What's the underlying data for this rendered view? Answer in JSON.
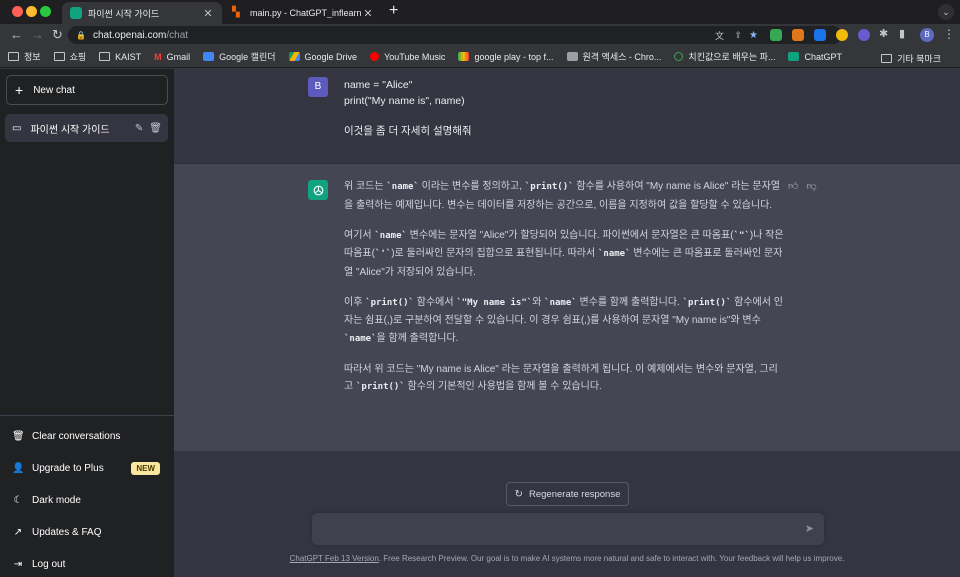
{
  "browser": {
    "tabs": [
      {
        "title": "파이썬 시작 가이드",
        "active": true,
        "favicon": "chatgpt-favicon-icon",
        "color": "#10a37f"
      },
      {
        "title": "main.py - ChatGPT_inflearn",
        "active": false,
        "favicon": "replit-favicon-icon",
        "color": "#f26207"
      }
    ],
    "new_tab": "+",
    "url_host": "chat.openai.com",
    "url_path": "/chat",
    "profile_initial": "B",
    "bookmarks": [
      {
        "label": "정보",
        "icon": "folder-icon"
      },
      {
        "label": "쇼핑",
        "icon": "folder-icon"
      },
      {
        "label": "KAIST",
        "icon": "folder-icon"
      },
      {
        "label": "Gmail",
        "icon": "gmail-icon"
      },
      {
        "label": "Google 캘린더",
        "icon": "calendar-icon"
      },
      {
        "label": "Google Drive",
        "icon": "drive-icon"
      },
      {
        "label": "YouTube Music",
        "icon": "youtube-music-icon"
      },
      {
        "label": "google play - top f...",
        "icon": "play-icon"
      },
      {
        "label": "원격 액세스 - Chro...",
        "icon": "remote-icon"
      },
      {
        "label": "치킨값으로 배우는 파...",
        "icon": "site-icon"
      },
      {
        "label": "ChatGPT",
        "icon": "chatgpt-icon"
      }
    ],
    "other_bookmarks": "기타 북마크"
  },
  "sidebar": {
    "new_chat": "New chat",
    "conversations": [
      {
        "title": "파이썬 시작 가이드"
      }
    ],
    "bottom_items": [
      {
        "label": "Clear conversations",
        "icon": "trash-icon",
        "glyph": "🗑"
      },
      {
        "label": "Upgrade to Plus",
        "icon": "user-icon",
        "glyph": "👤",
        "badge": "NEW"
      },
      {
        "label": "Dark mode",
        "icon": "moon-icon",
        "glyph": "☾"
      },
      {
        "label": "Updates & FAQ",
        "icon": "external-link-icon",
        "glyph": "↗"
      },
      {
        "label": "Log out",
        "icon": "logout-icon",
        "glyph": "⇥"
      }
    ]
  },
  "chat": {
    "user_avatar": "B",
    "user_lines": [
      "name = \"Alice\"",
      "print(\"My name is\", name)"
    ],
    "user_request": "이것을 좀 더 자세히 설명해줘",
    "bot_paragraphs": [
      [
        {
          "t": "위 코드는 "
        },
        {
          "c": "`name`"
        },
        {
          "t": " 이라는 변수를 정의하고, "
        },
        {
          "c": "`print()`"
        },
        {
          "t": " 함수를 사용하여 \"My name is Alice\" 라는 문자열을 출력하는 예제입니다. 변수는 데이터를 저장하는 공간으로, 이름을 지정하여 값을 할당할 수 있습니다."
        }
      ],
      [
        {
          "t": "여기서 "
        },
        {
          "c": "`name`"
        },
        {
          "t": " 변수에는 문자열 \"Alice\"가 할당되어 있습니다. 파이썬에서 문자열은 큰 따옴표("
        },
        {
          "c": "`\"`"
        },
        {
          "t": ")나 작은 따옴표("
        },
        {
          "c": "`'`"
        },
        {
          "t": ")로 둘러싸인 문자의 집합으로 표현됩니다. 따라서 "
        },
        {
          "c": "`name`"
        },
        {
          "t": " 변수에는 큰 따옴표로 둘러싸인 문자열 \"Alice\"가 저장되어 있습니다."
        }
      ],
      [
        {
          "t": "이후 "
        },
        {
          "c": "`print()`"
        },
        {
          "t": " 함수에서 "
        },
        {
          "c": "`\"My name is\"`"
        },
        {
          "t": "와 "
        },
        {
          "c": "`name`"
        },
        {
          "t": " 변수를 함께 출력합니다. "
        },
        {
          "c": "`print()`"
        },
        {
          "t": " 함수에서 인자는 쉼표(,)로 구분하여 전달할 수 있습니다. 이 경우 쉼표(,)를 사용하여 문자열 \"My name is\"와 변수 "
        },
        {
          "c": "`name`"
        },
        {
          "t": "을 함께 출력합니다."
        }
      ],
      [
        {
          "t": "따라서 위 코드는 \"My name is Alice\" 라는 문자열을 출력하게 됩니다. 이 예제에서는 변수와 문자열, 그리고 "
        },
        {
          "c": "`print()`"
        },
        {
          "t": " 함수의 기본적인 사용법을 함께 볼 수 있습니다."
        }
      ]
    ],
    "regenerate": "Regenerate response",
    "input_placeholder": "",
    "footer_link": "ChatGPT Feb 13 Version",
    "footer_text": ". Free Research Preview. Our goal is to make AI systems more natural and safe to interact with. Your feedback will help us improve."
  },
  "colors": {
    "sidebar_bg": "#202123",
    "main_bg": "#343541",
    "assistant_bg": "#444654",
    "gpt_green": "#10a37f",
    "new_badge": "#fae69e"
  }
}
